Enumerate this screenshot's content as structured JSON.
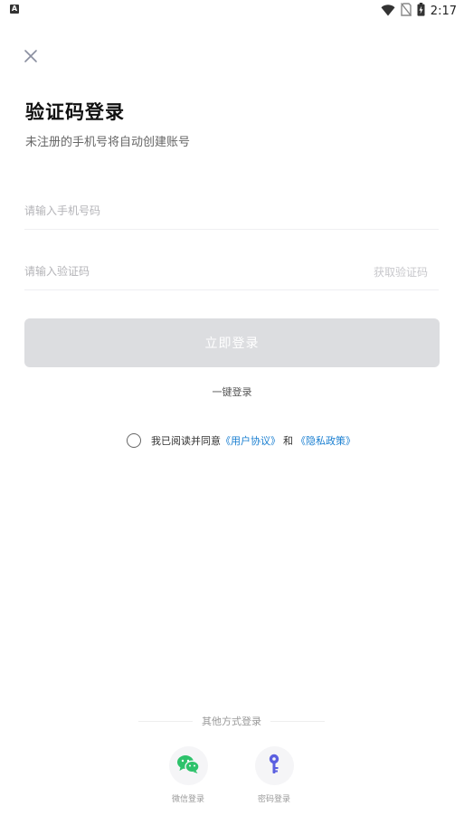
{
  "status_bar": {
    "notification_badge": "A",
    "time": "2:17",
    "icons": [
      "wifi-icon",
      "no-sim-icon",
      "battery-charging-icon"
    ]
  },
  "header": {
    "close_icon": "close-icon",
    "title": "验证码登录",
    "subtitle": "未注册的手机号将自动创建账号"
  },
  "form": {
    "phone_placeholder": "请输入手机号码",
    "code_placeholder": "请输入验证码",
    "get_code_label": "获取验证码",
    "login_button_label": "立即登录",
    "one_key_login_label": "一键登录"
  },
  "agreement": {
    "prefix": "我已阅读并同意",
    "user_agreement": "《用户协议》",
    "and": "和",
    "privacy_policy": "《隐私政策》"
  },
  "other_login": {
    "title": "其他方式登录",
    "wechat_label": "微信登录",
    "password_label": "密码登录"
  },
  "colors": {
    "accent_link": "#1a7fd1",
    "wechat_green": "#2dc26b",
    "key_purple": "#5b5fe0",
    "disabled_button": "#dcdde0"
  }
}
